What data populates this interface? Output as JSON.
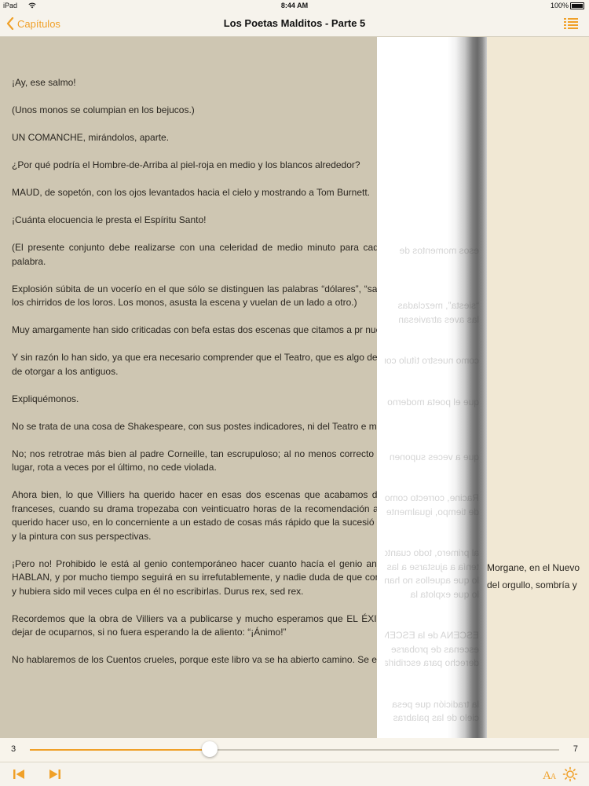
{
  "status_bar": {
    "carrier": "iPad",
    "time": "8:44 AM",
    "battery": "100%"
  },
  "nav": {
    "back_label": "Capítulos",
    "title": "Los Poetas Malditos - Parte 5"
  },
  "page": {
    "paragraphs": [
      "¡Ay, ese salmo!",
      "(Unos monos se columpian en los bejucos.)",
      "UN COMANCHE, mirándolos, aparte.",
      "¿Por qué podría el Hombre-de-Arriba al piel-roja en medio y los blancos alrededor?",
      "MAUD, de sopetón, con los ojos levantados hacia el cielo y mostrando a Tom Burnett.",
      "¡Cuánta elocuencia le presta el Espíritu Santo!",
      "(El presente conjunto debe realizarse con una celeridad de medio minuto para cada confusión en que la muchedumbre toma la palabra.",
      "Explosión súbita de un vocerío en el que sólo se distinguen las palabras “dólares”, “salm a los ladridos, a las greguerías infantiles y a los chirridos de los loros. Los monos, asusta la escena y vuelan de un lado a otro.)",
      "Muy amargamente han sido criticadas con befa estas dos escenas que citamos a pr nuestro asunto.",
      "Y sin razón lo han sido, ya que era necesario comprender que el Teatro, que es algo de c las concesiones que no ha podido por menos de otorgar a los antiguos.",
      "Expliquémonos.",
      "No se trata de una cosa de Shakespeare, con sus postes indicadores, ni del Teatro e muchísimos años.",
      "No; nos retrotrae más bien al padre Corneille, tan escrupuloso; al no menos correcto qu uno y ternísimo como el otro. La unidad del lugar, rota a veces por el último, no cede violada.",
      "Ahora bien, lo que Villiers ha querido hacer en esas dos escenas que acabamos de ofre las Tablas permitían a los tres clásicos franceses, cuando su drama tropezaba con veinticuatro horas de la recomendación atribuida al difunto Aristóteles; y en la segunda, querido hacer uso, en lo concerniente a un estado de cosas más rápido que la sucesió música todos los días con sus dúos, tríos y tutti, y la pintura con sus perspectivas.",
      "¡Pero no! Prohibido le está al genio contemporáneo hacer cuanto hacía el genio antig MUDA y de LA ESCENA EN QUE TODOS HABLAN, y por mucho tiempo seguirá en su irrefutablemente, y nadie duda de que convendréis que Villiers no sólo tenía derecho, sin y hubiera sido mil veces culpa en él no escribirlas. Durus rex, sed rex.",
      "Recordemos que la obra de Villiers va a publicarse y mucho esperamos que EL ÉXITO sobre el admirable poeta del que sentimos dejar de ocuparnos, si no fuera esperando la de aliento: “¡Ánimo!”",
      "No hablaremos de los Cuentos crueles, porque este libro va se ha abierto camino. Se e"
    ],
    "ghost_lines": [
      "esos momentos de",
      "",
      "",
      "",
      "“siesta”, mezcladas",
      "las aves atraviesan",
      "",
      "",
      "como nuestro título con",
      "",
      "",
      "que el poeta moderno",
      "",
      "",
      "",
      "que a veces suponen",
      "",
      "",
      "Racine, correcto como el",
      "de tiempo, igualmente",
      "",
      "",
      "al primero, todo cuanto",
      "tenía a ajustarse a las",
      "lo que aquellos no han",
      "lo que explota la",
      "",
      "",
      "ESCENA de la ESCENA",
      "escenas de probarse",
      "derecho para escribirlas,",
      "",
      "",
      "la tradición que pesa",
      "cielo de las palabras",
      "",
      "",
      "veces de la madurez"
    ],
    "right_fragments": {
      "line1": "Morgane, en el Nuevo",
      "line2": "del orgullo, sombría y"
    }
  },
  "slider": {
    "start_label": "3",
    "end_label": "7",
    "progress": 0.34
  },
  "toolbar": {
    "prev_icon": "skip-back-icon",
    "next_icon": "skip-forward-icon",
    "font_icon": "font-size-icon",
    "brightness_icon": "brightness-icon"
  },
  "colors": {
    "accent": "#f0a028",
    "page_shade": "#cec6b2",
    "page_bg": "#f1e8d4"
  }
}
